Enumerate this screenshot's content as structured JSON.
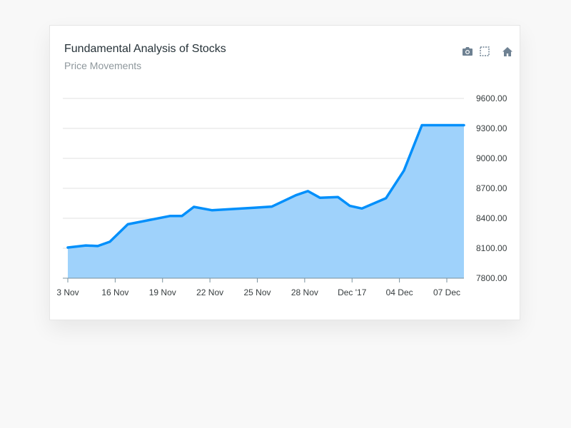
{
  "header": {
    "title": "Fundamental Analysis of Stocks",
    "subtitle": "Price Movements"
  },
  "toolbar": {
    "icons": [
      "camera-icon",
      "selection-zoom-icon",
      "home-icon"
    ]
  },
  "colors": {
    "line": "#008ffb",
    "fill": "#9fd2fb",
    "grid": "#e0e0e0",
    "axis": "#78909c",
    "icon": "#6e8192"
  },
  "chart_data": {
    "type": "area",
    "title": "Fundamental Analysis of Stocks",
    "subtitle": "Price Movements",
    "x_dates": [
      "2017-11-03",
      "2017-11-06",
      "2017-11-08",
      "2017-11-10",
      "2017-11-13",
      "2017-11-20",
      "2017-11-22",
      "2017-11-24",
      "2017-11-27",
      "2017-12-04",
      "2017-12-07",
      "2017-12-11",
      "2017-12-13",
      "2017-12-15",
      "2017-12-18",
      "2017-12-20",
      "2017-12-22",
      "2017-12-26",
      "2017-12-29",
      "2018-01-01",
      "2018-01-03",
      "2018-01-05",
      "2018-01-08"
    ],
    "y": [
      8107,
      8128,
      8122,
      8165,
      8340,
      8423,
      8423,
      8514,
      8481,
      8505,
      8517,
      8631,
      8672,
      8606,
      8613,
      8524,
      8498,
      8601,
      8877,
      9332,
      9332,
      9332,
      9332
    ],
    "y_axis_position": "right",
    "ylim": [
      7800,
      9600
    ],
    "yticks": [
      "9600.00",
      "9300.00",
      "9000.00",
      "8700.00",
      "8400.00",
      "8100.00",
      "7800.00"
    ],
    "xticks": [
      "3 Nov",
      "16 Nov",
      "19 Nov",
      "22 Nov",
      "25 Nov",
      "28 Nov",
      "Dec '17",
      "04 Dec",
      "07 Dec"
    ],
    "grid": true,
    "legend": "none"
  }
}
